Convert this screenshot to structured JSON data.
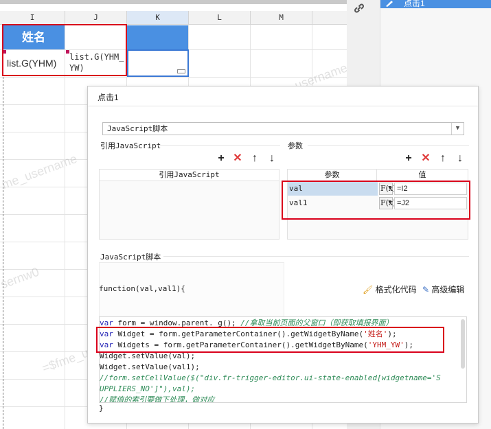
{
  "sheet": {
    "columns": [
      "I",
      "J",
      "K",
      "L",
      "M"
    ],
    "header_cell": "姓名",
    "cell_i2": "list.G(YHM)",
    "cell_j2_line1": "list.G(YHM_",
    "cell_j2_line2": "YW)",
    "watermark_1": "me_username",
    "watermark_2": "=$fme_u",
    "watermark_3": "sernw0",
    "watermark_4": "$fine_username"
  },
  "right_panel": {
    "top_item_label": "点击1"
  },
  "dialog": {
    "title": "点击1",
    "type_select_value": "JavaScript脚本",
    "ref_js_section_label": "引用JavaScript",
    "ref_js_column_header": "引用JavaScript",
    "params_section_label": "参数",
    "params_headers": [
      "参数",
      "值"
    ],
    "params": [
      {
        "name": "val",
        "value": "=I2"
      },
      {
        "name": "val1",
        "value": "=J2"
      }
    ],
    "fx_label": "F(x)",
    "script_section_label": "JavaScript脚本",
    "function_signature": "function(val,val1){",
    "format_code_label": "格式化代码",
    "advanced_edit_label": "高级编辑",
    "closing_brace": "}"
  },
  "code": {
    "line1_kw": "var",
    "line1_rest": " form = window.parent. g(); ",
    "line1_comment": "//拿取当前页面的父窗口（即获取填报界面）",
    "line2_kw": "var",
    "line2_rest": " Widget = form.getParameterContainer().getWidgetByName(",
    "line2_str": "'姓名'",
    "line2_end": ");",
    "line3_kw": "var",
    "line3_rest": " Widgets = form.getParameterContainer().getWidgetByName(",
    "line3_str": "'YHM_YW'",
    "line3_end": ");",
    "line4": "Widget.setValue(val);",
    "line5": "Widget.setValue(val1);",
    "line6": "//form.setCellValue($(\"div.fr-trigger-editor.ui-state-enabled[widgetname='S",
    "line7": "UPPLIERS_NO']\"),val);",
    "line8": "//赋值的索引要做下处理，做对应"
  }
}
